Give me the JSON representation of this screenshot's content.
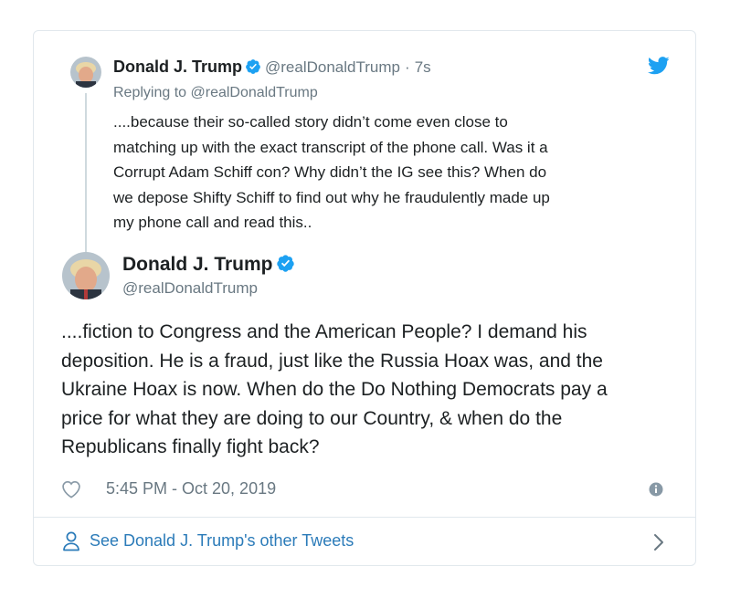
{
  "parent_tweet": {
    "name": "Donald J. Trump",
    "handle": "@realDonaldTrump",
    "separator": "·",
    "time": "7s",
    "replying_to": "Replying to @realDonaldTrump",
    "text_lines": [
      "....because their so-called story didn’t come even close to",
      "matching up with the exact transcript of the phone call. Was it a",
      "Corrupt Adam Schiff con? Why didn’t the IG see this? When do",
      "we depose Shifty Schiff to find out why he fraudulently made up",
      "my phone call and read this.."
    ]
  },
  "main_tweet": {
    "name": "Donald J. Trump",
    "handle": "@realDonaldTrump",
    "text_lines": [
      "....fiction to Congress and the American People?  I demand his",
      "deposition. He is a fraud, just like the Russia Hoax was, and the",
      "Ukraine Hoax is now. When do the Do Nothing Democrats pay a",
      "price for what they are doing to our Country, & when do the",
      "Republicans finally fight back?"
    ],
    "timestamp": "5:45 PM - Oct 20, 2019"
  },
  "footer": {
    "label": "See Donald J. Trump's other Tweets"
  },
  "icons": {
    "verified": "verified-badge-icon",
    "bird": "twitter-bird-icon",
    "heart": "heart-icon",
    "info": "info-icon",
    "person": "person-icon",
    "chevron": "chevron-right-icon"
  },
  "colors": {
    "twitter_blue": "#1da1f2",
    "link_blue": "#2b7bb9",
    "muted_text": "#697882",
    "border": "#e1e8ed"
  }
}
